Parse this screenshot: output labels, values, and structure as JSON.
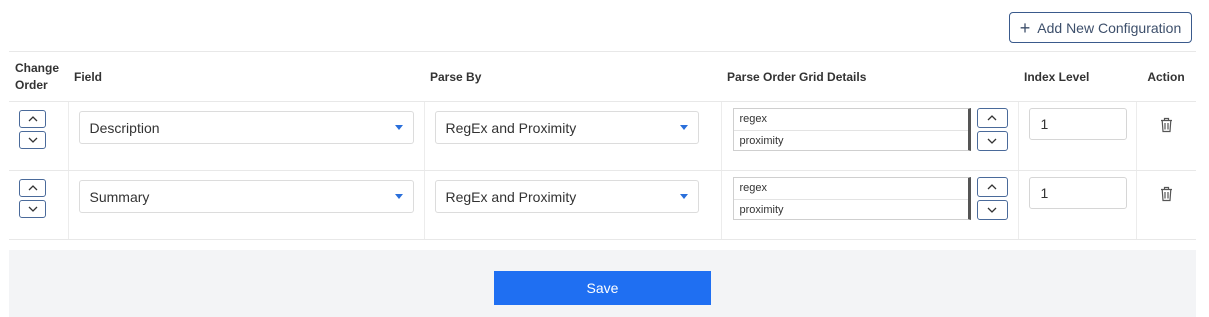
{
  "toolbar": {
    "add_label": "Add New Configuration",
    "add_icon": "plus-icon"
  },
  "table": {
    "headers": {
      "change_order_line1": "Change",
      "change_order_line2": "Order",
      "field": "Field",
      "parse_by": "Parse By",
      "grid_details": "Parse Order Grid Details",
      "index_level": "Index Level",
      "action": "Action"
    },
    "rows": [
      {
        "field": "Description",
        "parse_by": "RegEx and Proximity",
        "grid": [
          "regex",
          "proximity"
        ],
        "index_level": "1"
      },
      {
        "field": "Summary",
        "parse_by": "RegEx and Proximity",
        "grid": [
          "regex",
          "proximity"
        ],
        "index_level": "1"
      }
    ]
  },
  "footer": {
    "save_label": "Save"
  },
  "colors": {
    "primary": "#1f6ff2",
    "caret": "#2a6fdb",
    "arrow_border": "#4a6a9a",
    "footer_bg": "#f3f4f6"
  }
}
